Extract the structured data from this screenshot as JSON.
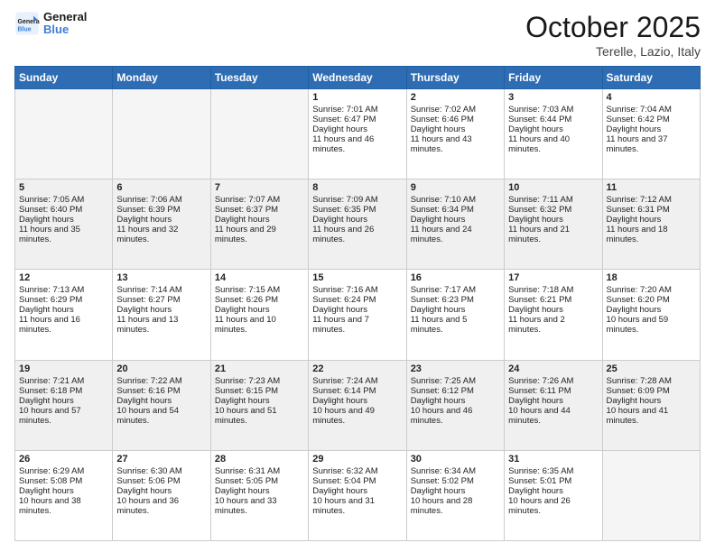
{
  "logo": {
    "text_general": "General",
    "text_blue": "Blue"
  },
  "header": {
    "month": "October 2025",
    "location": "Terelle, Lazio, Italy"
  },
  "days": [
    "Sunday",
    "Monday",
    "Tuesday",
    "Wednesday",
    "Thursday",
    "Friday",
    "Saturday"
  ],
  "weeks": [
    [
      {
        "day": null,
        "sunrise": null,
        "sunset": null,
        "daylight": null
      },
      {
        "day": null,
        "sunrise": null,
        "sunset": null,
        "daylight": null
      },
      {
        "day": null,
        "sunrise": null,
        "sunset": null,
        "daylight": null
      },
      {
        "day": "1",
        "sunrise": "7:01 AM",
        "sunset": "6:47 PM",
        "daylight": "11 hours and 46 minutes."
      },
      {
        "day": "2",
        "sunrise": "7:02 AM",
        "sunset": "6:46 PM",
        "daylight": "11 hours and 43 minutes."
      },
      {
        "day": "3",
        "sunrise": "7:03 AM",
        "sunset": "6:44 PM",
        "daylight": "11 hours and 40 minutes."
      },
      {
        "day": "4",
        "sunrise": "7:04 AM",
        "sunset": "6:42 PM",
        "daylight": "11 hours and 37 minutes."
      }
    ],
    [
      {
        "day": "5",
        "sunrise": "7:05 AM",
        "sunset": "6:40 PM",
        "daylight": "11 hours and 35 minutes."
      },
      {
        "day": "6",
        "sunrise": "7:06 AM",
        "sunset": "6:39 PM",
        "daylight": "11 hours and 32 minutes."
      },
      {
        "day": "7",
        "sunrise": "7:07 AM",
        "sunset": "6:37 PM",
        "daylight": "11 hours and 29 minutes."
      },
      {
        "day": "8",
        "sunrise": "7:09 AM",
        "sunset": "6:35 PM",
        "daylight": "11 hours and 26 minutes."
      },
      {
        "day": "9",
        "sunrise": "7:10 AM",
        "sunset": "6:34 PM",
        "daylight": "11 hours and 24 minutes."
      },
      {
        "day": "10",
        "sunrise": "7:11 AM",
        "sunset": "6:32 PM",
        "daylight": "11 hours and 21 minutes."
      },
      {
        "day": "11",
        "sunrise": "7:12 AM",
        "sunset": "6:31 PM",
        "daylight": "11 hours and 18 minutes."
      }
    ],
    [
      {
        "day": "12",
        "sunrise": "7:13 AM",
        "sunset": "6:29 PM",
        "daylight": "11 hours and 16 minutes."
      },
      {
        "day": "13",
        "sunrise": "7:14 AM",
        "sunset": "6:27 PM",
        "daylight": "11 hours and 13 minutes."
      },
      {
        "day": "14",
        "sunrise": "7:15 AM",
        "sunset": "6:26 PM",
        "daylight": "11 hours and 10 minutes."
      },
      {
        "day": "15",
        "sunrise": "7:16 AM",
        "sunset": "6:24 PM",
        "daylight": "11 hours and 7 minutes."
      },
      {
        "day": "16",
        "sunrise": "7:17 AM",
        "sunset": "6:23 PM",
        "daylight": "11 hours and 5 minutes."
      },
      {
        "day": "17",
        "sunrise": "7:18 AM",
        "sunset": "6:21 PM",
        "daylight": "11 hours and 2 minutes."
      },
      {
        "day": "18",
        "sunrise": "7:20 AM",
        "sunset": "6:20 PM",
        "daylight": "10 hours and 59 minutes."
      }
    ],
    [
      {
        "day": "19",
        "sunrise": "7:21 AM",
        "sunset": "6:18 PM",
        "daylight": "10 hours and 57 minutes."
      },
      {
        "day": "20",
        "sunrise": "7:22 AM",
        "sunset": "6:16 PM",
        "daylight": "10 hours and 54 minutes."
      },
      {
        "day": "21",
        "sunrise": "7:23 AM",
        "sunset": "6:15 PM",
        "daylight": "10 hours and 51 minutes."
      },
      {
        "day": "22",
        "sunrise": "7:24 AM",
        "sunset": "6:14 PM",
        "daylight": "10 hours and 49 minutes."
      },
      {
        "day": "23",
        "sunrise": "7:25 AM",
        "sunset": "6:12 PM",
        "daylight": "10 hours and 46 minutes."
      },
      {
        "day": "24",
        "sunrise": "7:26 AM",
        "sunset": "6:11 PM",
        "daylight": "10 hours and 44 minutes."
      },
      {
        "day": "25",
        "sunrise": "7:28 AM",
        "sunset": "6:09 PM",
        "daylight": "10 hours and 41 minutes."
      }
    ],
    [
      {
        "day": "26",
        "sunrise": "6:29 AM",
        "sunset": "5:08 PM",
        "daylight": "10 hours and 38 minutes."
      },
      {
        "day": "27",
        "sunrise": "6:30 AM",
        "sunset": "5:06 PM",
        "daylight": "10 hours and 36 minutes."
      },
      {
        "day": "28",
        "sunrise": "6:31 AM",
        "sunset": "5:05 PM",
        "daylight": "10 hours and 33 minutes."
      },
      {
        "day": "29",
        "sunrise": "6:32 AM",
        "sunset": "5:04 PM",
        "daylight": "10 hours and 31 minutes."
      },
      {
        "day": "30",
        "sunrise": "6:34 AM",
        "sunset": "5:02 PM",
        "daylight": "10 hours and 28 minutes."
      },
      {
        "day": "31",
        "sunrise": "6:35 AM",
        "sunset": "5:01 PM",
        "daylight": "10 hours and 26 minutes."
      },
      {
        "day": null,
        "sunrise": null,
        "sunset": null,
        "daylight": null
      }
    ]
  ]
}
